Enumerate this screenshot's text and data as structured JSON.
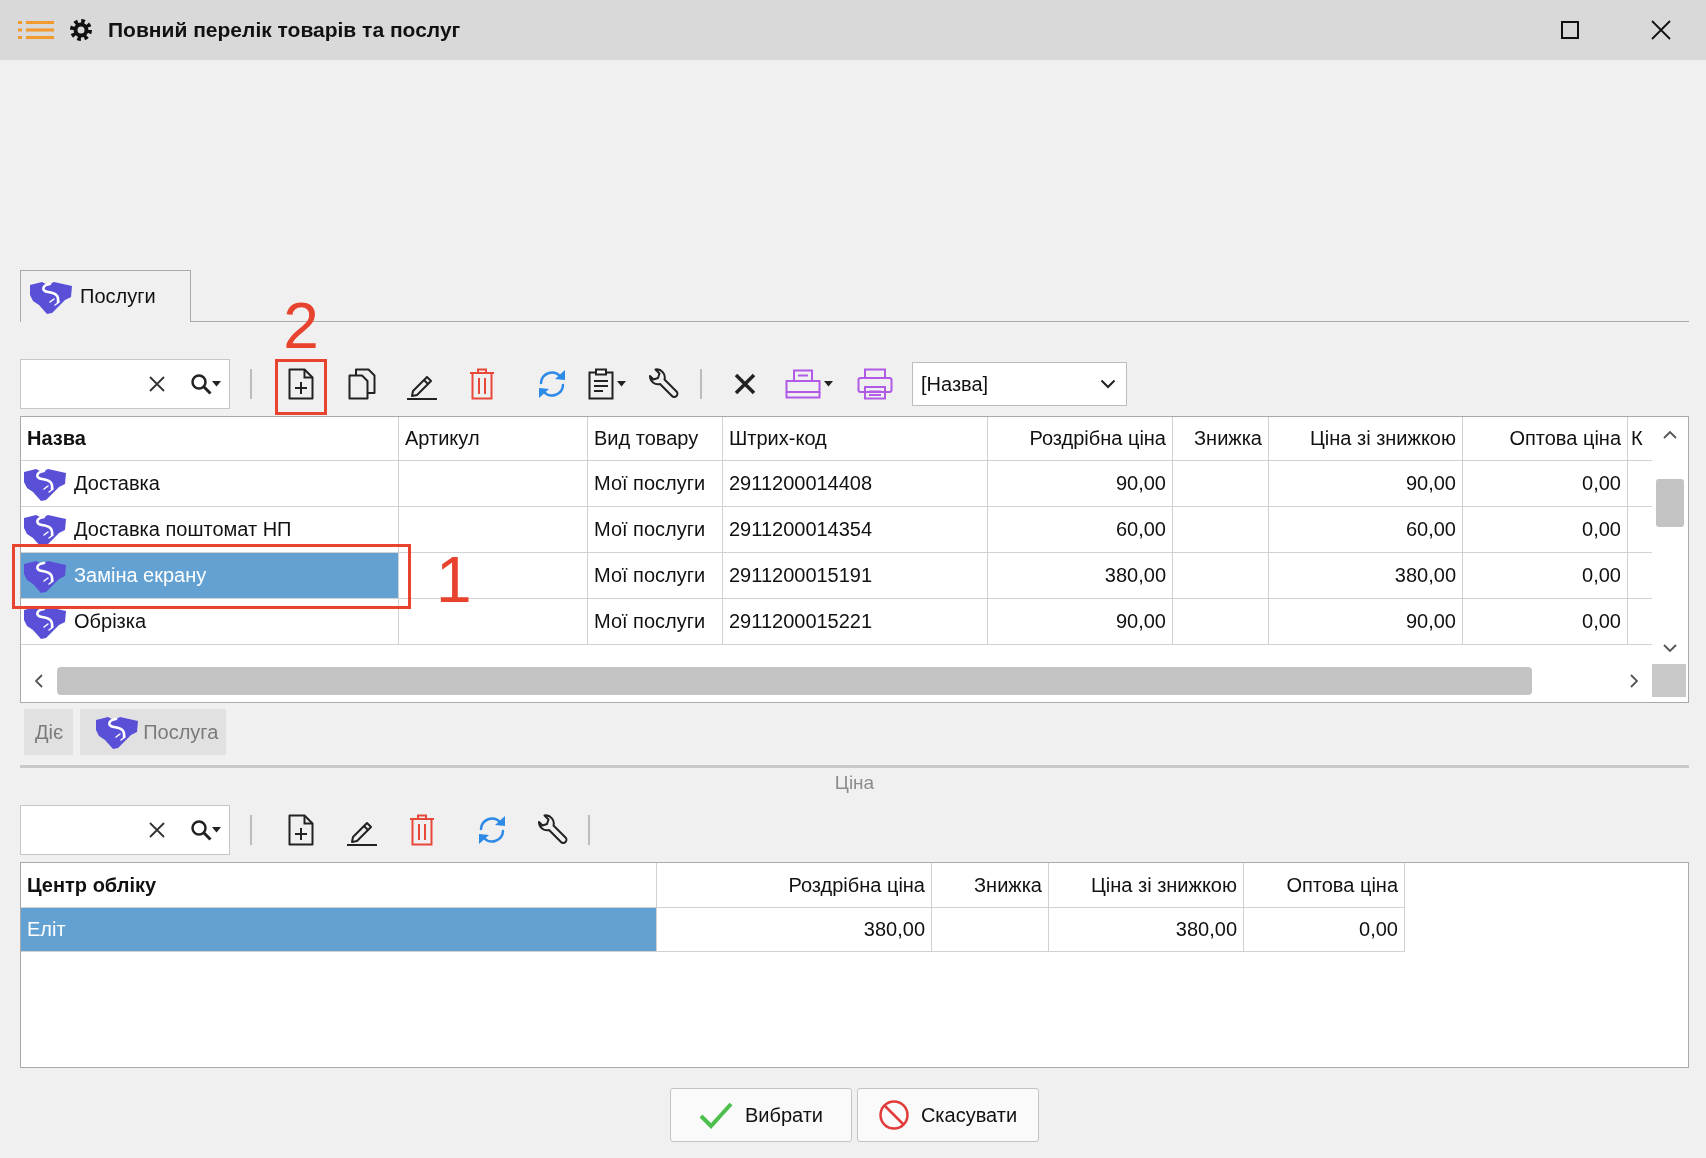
{
  "window": {
    "title": "Повний перелік товарів та послуг"
  },
  "tabs": [
    {
      "label": "Послуги",
      "selected": true
    }
  ],
  "toolbar": {
    "sort_field": "[Назва]",
    "callout": "2"
  },
  "services_table": {
    "columns": [
      {
        "label": "Назва"
      },
      {
        "label": "Артикул"
      },
      {
        "label": "Вид товару"
      },
      {
        "label": "Штрих-код"
      },
      {
        "label": "Роздрібна ціна"
      },
      {
        "label": "Знижка"
      },
      {
        "label": "Ціна зі знижкою"
      },
      {
        "label": "Оптова ціна"
      },
      {
        "label": "К"
      }
    ],
    "rows": [
      {
        "name": "Доставка",
        "type": "Мої послуги",
        "barcode": "2911200014408",
        "retail_price": "90,00",
        "discounted_price": "90,00",
        "wholesale_price": "0,00",
        "selected": false
      },
      {
        "name": "Доставка поштомат НП",
        "type": "Мої послуги",
        "barcode": "2911200014354",
        "retail_price": "60,00",
        "discounted_price": "60,00",
        "wholesale_price": "0,00",
        "selected": false
      },
      {
        "name": "Заміна екрану",
        "type": "Мої послуги",
        "barcode": "2911200015191",
        "retail_price": "380,00",
        "discounted_price": "380,00",
        "wholesale_price": "0,00",
        "selected": true,
        "callout": "1"
      },
      {
        "name": "Обрізка",
        "type": "Мої послуги",
        "barcode": "2911200015221",
        "retail_price": "90,00",
        "discounted_price": "90,00",
        "wholesale_price": "0,00",
        "selected": false
      }
    ]
  },
  "detail_tabs": [
    {
      "label": "Діє",
      "kind": "text",
      "disabled": true
    },
    {
      "label": "Послуга",
      "kind": "service",
      "disabled": true
    }
  ],
  "price_section": {
    "title": "Ціна"
  },
  "prices_table": {
    "columns": [
      {
        "label": "Центр обліку"
      },
      {
        "label": "Роздрібна ціна"
      },
      {
        "label": "Знижка"
      },
      {
        "label": "Ціна зі знижкою"
      },
      {
        "label": "Оптова ціна"
      }
    ],
    "rows": [
      {
        "center": "Еліт",
        "retail_price": "380,00",
        "discounted_price": "380,00",
        "wholesale_price": "0,00",
        "selected": true
      }
    ]
  },
  "buttons": [
    {
      "label": "Вибрати",
      "kind": "confirm"
    },
    {
      "label": "Скасувати",
      "kind": "cancel"
    }
  ]
}
